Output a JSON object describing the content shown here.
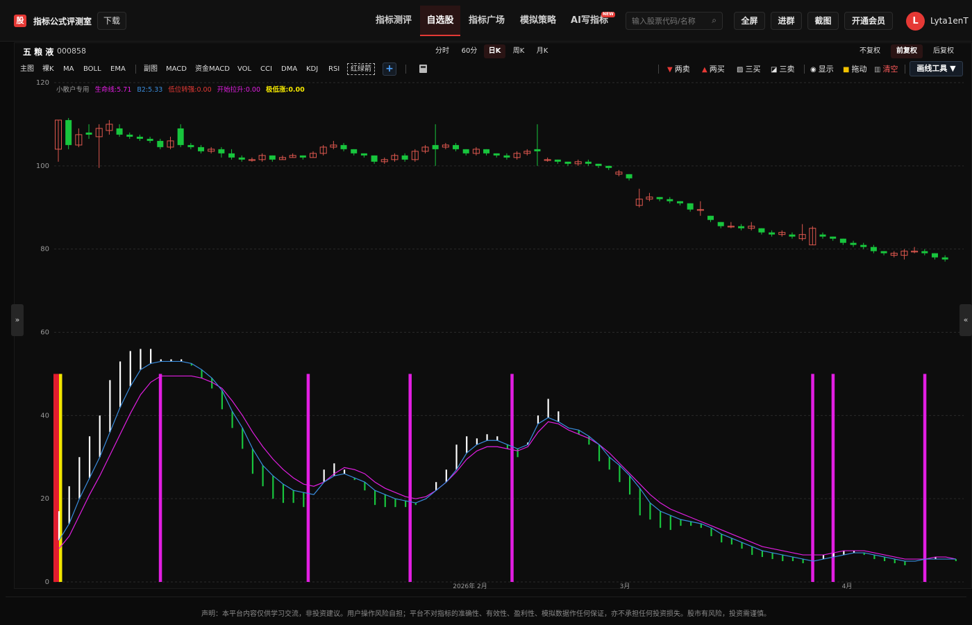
{
  "app": {
    "logo_char": "股",
    "title": "指标公式评测室",
    "download": "下载"
  },
  "nav": [
    {
      "label": "指标测评",
      "active": false
    },
    {
      "label": "自选股",
      "active": true
    },
    {
      "label": "指标广场",
      "active": false
    },
    {
      "label": "模拟策略",
      "active": false
    },
    {
      "label": "AI写指标",
      "active": false,
      "badge": "NEW"
    }
  ],
  "search": {
    "placeholder": "输入股票代码/名称",
    "value": ""
  },
  "top_buttons": {
    "fullscreen": "全屏",
    "join_group": "进群",
    "screenshot": "截图",
    "membership": "开通会员"
  },
  "user": {
    "avatar_letter": "L",
    "name": "Lyta1enT"
  },
  "stock": {
    "name": "五 粮 液",
    "code": "000858"
  },
  "period_tabs": [
    {
      "label": "分时",
      "active": false
    },
    {
      "label": "60分",
      "active": false
    },
    {
      "label": "日K",
      "active": true
    },
    {
      "label": "周K",
      "active": false
    },
    {
      "label": "月K",
      "active": false
    }
  ],
  "adjust_tabs": [
    {
      "label": "不复权",
      "active": false
    },
    {
      "label": "前复权",
      "active": true
    },
    {
      "label": "后复权",
      "active": false
    }
  ],
  "indicator_tabs": [
    "主图",
    "裸K",
    "MA",
    "BOLL",
    "EMA",
    "副图",
    "MACD",
    "资金MACD",
    "VOL",
    "CCI",
    "DMA",
    "KDJ",
    "RSI",
    "红绿箭"
  ],
  "draw_tools": {
    "two_sell": "两卖",
    "two_buy": "两买",
    "three_buy": "三买",
    "three_sell": "三卖",
    "show": "显示",
    "drag": "拖动",
    "clear": "清空",
    "draw_tools_btn": "画线工具 ▼"
  },
  "indicator_legend": [
    {
      "label": "小散户专用",
      "color": "#9a9a9a"
    },
    {
      "label": "生命线:5.71",
      "color": "#e21ee2"
    },
    {
      "label": "B2:5.33",
      "color": "#3a8dde"
    },
    {
      "label": "低位转强:0.00",
      "color": "#e53935"
    },
    {
      "label": "开始拉升:0.00",
      "color": "#e21ee2"
    },
    {
      "label": "极低涨:0.00",
      "color": "#f2e600"
    }
  ],
  "colors": {
    "up": "#e0584f",
    "down": "#18c53d",
    "magenta": "#e21ee2",
    "blue": "#3a8dde",
    "yellow": "#f2e600",
    "red": "#e11d2e"
  },
  "chart_data": {
    "type": "candlestick",
    "y_axis_labels": [
      "120",
      "100",
      "80",
      "60",
      "40",
      "20",
      "0"
    ],
    "x_axis_labels": [
      "2026年 2月",
      "3月",
      "4月"
    ],
    "y_range": [
      0,
      120
    ],
    "candles": [
      [
        104,
        111,
        101,
        111
      ],
      [
        111,
        105,
        104,
        111.5
      ],
      [
        105,
        107.5,
        104.5,
        109
      ],
      [
        108,
        107.5,
        106.5,
        110
      ],
      [
        107,
        109,
        99.5,
        110
      ],
      [
        108.5,
        110,
        107.5,
        111
      ],
      [
        109,
        107.5,
        107,
        110
      ],
      [
        107.5,
        107,
        106.5,
        108
      ],
      [
        107,
        106.5,
        106,
        107.5
      ],
      [
        106.5,
        106,
        105.5,
        107
      ],
      [
        106,
        104.5,
        104,
        106.5
      ],
      [
        104.5,
        106,
        104,
        107
      ],
      [
        109,
        105,
        104.5,
        110
      ],
      [
        105,
        104.5,
        104,
        105.5
      ],
      [
        104.5,
        103.5,
        103,
        105
      ],
      [
        103.5,
        104,
        103,
        104.5
      ],
      [
        104,
        103,
        102,
        104.5
      ],
      [
        103,
        102,
        101.5,
        104
      ],
      [
        102,
        101.5,
        101,
        102.5
      ],
      [
        101.5,
        101.5,
        101,
        102
      ],
      [
        101.5,
        102.5,
        101,
        103
      ],
      [
        102.5,
        101.5,
        101,
        102.5
      ],
      [
        101.5,
        102,
        101.5,
        102.5
      ],
      [
        102,
        102.5,
        102,
        103
      ],
      [
        102.5,
        102,
        101.5,
        102.5
      ],
      [
        102,
        103,
        102,
        103.5
      ],
      [
        103,
        104.5,
        102.5,
        105
      ],
      [
        104.5,
        105,
        104,
        106
      ],
      [
        105,
        104,
        103.5,
        105.5
      ],
      [
        104,
        103,
        102.5,
        104
      ],
      [
        103,
        102.5,
        102,
        103
      ],
      [
        102.5,
        101,
        100.5,
        102.5
      ],
      [
        101,
        101.5,
        100.5,
        102
      ],
      [
        101.5,
        102.5,
        101,
        103
      ],
      [
        102.5,
        101.5,
        101,
        103
      ],
      [
        101.5,
        103.5,
        101,
        104
      ],
      [
        103.5,
        104.5,
        103,
        105
      ],
      [
        105,
        104,
        100,
        110
      ],
      [
        104.5,
        105,
        104,
        105.5
      ],
      [
        105,
        104,
        103.5,
        105.5
      ],
      [
        104,
        103,
        102.5,
        104
      ],
      [
        103,
        104,
        102.5,
        104.5
      ],
      [
        104,
        103,
        102.5,
        104
      ],
      [
        103,
        102.5,
        102,
        103
      ],
      [
        102.5,
        102,
        101.5,
        103
      ],
      [
        102,
        103,
        101.5,
        103.5
      ],
      [
        103,
        103.5,
        102.5,
        104
      ],
      [
        104,
        103.5,
        100,
        110
      ],
      [
        101.5,
        101.5,
        101,
        102
      ],
      [
        101.5,
        101,
        100.5,
        101.5
      ],
      [
        101,
        100.5,
        100,
        101
      ],
      [
        100.5,
        101,
        100,
        101.5
      ],
      [
        101,
        100.5,
        100,
        101.5
      ],
      [
        100.5,
        100,
        99.5,
        100.5
      ],
      [
        100,
        99.5,
        99,
        100
      ],
      [
        98,
        98.5,
        97.5,
        99
      ],
      [
        98,
        97,
        96.5,
        98
      ],
      [
        90.5,
        92,
        90,
        94.5
      ],
      [
        92,
        92.5,
        91.5,
        93.5
      ],
      [
        92.5,
        92,
        91.5,
        92.5
      ],
      [
        92,
        91.5,
        91,
        92.5
      ],
      [
        91.5,
        91,
        90.5,
        91.5
      ],
      [
        91,
        89.5,
        89,
        91
      ],
      [
        89.5,
        89.5,
        88,
        91.5
      ],
      [
        88,
        87,
        86.5,
        88
      ],
      [
        86.5,
        85.5,
        85,
        86.5
      ],
      [
        85.5,
        85.5,
        85,
        86.5
      ],
      [
        85.5,
        85,
        84.5,
        86
      ],
      [
        85,
        85.5,
        84.5,
        86.5
      ],
      [
        85,
        84,
        83.5,
        85
      ],
      [
        84,
        83.5,
        83,
        84.5
      ],
      [
        83.5,
        84,
        83,
        84.5
      ],
      [
        83.5,
        83,
        82.5,
        84
      ],
      [
        82.5,
        83.5,
        82,
        86
      ],
      [
        81,
        85,
        81,
        85.5
      ],
      [
        83.5,
        83,
        82.5,
        84
      ],
      [
        83,
        82.5,
        82,
        83
      ],
      [
        82.5,
        81.5,
        81,
        82.5
      ],
      [
        81.5,
        81,
        80.5,
        82
      ],
      [
        81,
        80.5,
        80,
        81.5
      ],
      [
        80.5,
        79.5,
        79,
        81
      ],
      [
        79.5,
        79,
        78.5,
        79.5
      ],
      [
        78.5,
        79,
        78,
        79.5
      ],
      [
        78.5,
        79.5,
        77.5,
        80
      ],
      [
        79.5,
        79.5,
        79,
        80.5
      ],
      [
        79.5,
        79,
        78.5,
        80
      ],
      [
        79,
        78,
        77.5,
        79
      ],
      [
        78,
        77.5,
        77,
        78.5
      ]
    ],
    "sub_bars": [
      [
        10,
        17,
        10
      ],
      [
        14,
        23,
        14
      ],
      [
        20,
        30,
        20
      ],
      [
        25,
        35,
        25
      ],
      [
        30,
        40,
        30
      ],
      [
        36,
        48.5,
        36
      ],
      [
        42,
        53,
        42
      ],
      [
        47,
        55.5,
        47
      ],
      [
        51,
        56,
        51
      ],
      [
        52.5,
        56,
        52
      ],
      [
        53,
        53.5,
        52.5
      ],
      [
        53,
        53.5,
        52.5
      ],
      [
        53,
        53.5,
        52.5
      ],
      [
        52.5,
        52,
        52.5
      ],
      [
        51,
        49,
        51
      ],
      [
        49,
        46.5,
        49
      ],
      [
        46,
        41.5,
        46
      ],
      [
        41,
        37,
        41
      ],
      [
        37,
        32,
        37
      ],
      [
        32,
        26,
        32
      ],
      [
        28,
        23,
        28
      ],
      [
        25.5,
        20,
        25.5
      ],
      [
        23.5,
        19,
        23.5
      ],
      [
        22,
        19,
        22
      ],
      [
        21.5,
        18,
        21.5
      ],
      [
        21,
        21,
        21
      ],
      [
        24,
        27,
        24
      ],
      [
        25.5,
        28.5,
        25.5
      ],
      [
        26,
        27,
        26
      ],
      [
        25,
        24.5,
        25
      ],
      [
        24,
        22,
        24
      ],
      [
        22,
        18.5,
        22
      ],
      [
        21,
        18,
        21
      ],
      [
        20,
        18,
        20
      ],
      [
        19.5,
        18,
        19.5
      ],
      [
        19,
        18.5,
        19
      ],
      [
        20,
        20,
        20
      ],
      [
        22,
        24,
        22
      ],
      [
        24,
        27,
        24
      ],
      [
        27,
        33,
        27
      ],
      [
        31,
        35,
        31
      ],
      [
        33,
        34.5,
        33
      ],
      [
        34,
        35.5,
        34
      ],
      [
        34,
        35,
        34
      ],
      [
        33,
        32,
        33
      ],
      [
        32,
        30,
        32
      ],
      [
        33,
        33.5,
        33
      ],
      [
        38,
        40,
        38
      ],
      [
        39.5,
        44,
        39.5
      ],
      [
        38.5,
        41,
        38.5
      ],
      [
        37,
        37,
        37
      ],
      [
        36.5,
        35.5,
        36.5
      ],
      [
        35,
        33,
        35
      ],
      [
        33,
        29,
        33
      ],
      [
        30,
        27,
        30
      ],
      [
        28,
        24,
        28
      ],
      [
        25.5,
        21,
        25.5
      ],
      [
        22.5,
        16,
        22.5
      ],
      [
        19,
        15,
        19
      ],
      [
        17,
        13,
        17
      ],
      [
        16,
        12.5,
        16
      ],
      [
        15,
        13.5,
        15
      ],
      [
        14.5,
        13.5,
        14.5
      ],
      [
        14,
        13,
        14
      ],
      [
        13,
        11,
        13
      ],
      [
        11.5,
        9.5,
        11.5
      ],
      [
        10.5,
        9,
        10.5
      ],
      [
        9.5,
        8,
        9.5
      ],
      [
        8.5,
        6.5,
        8.5
      ],
      [
        7.5,
        6,
        7.5
      ],
      [
        7,
        5.5,
        7
      ],
      [
        6.5,
        5,
        6.5
      ],
      [
        6,
        5,
        6
      ],
      [
        5.5,
        4.5,
        5.5
      ],
      [
        5,
        5,
        5
      ],
      [
        5.5,
        6.5,
        5.5
      ],
      [
        6,
        7,
        6
      ],
      [
        6.5,
        7.5,
        6.5
      ],
      [
        7,
        7.5,
        7
      ],
      [
        7,
        6.5,
        7
      ],
      [
        6.5,
        5.5,
        6.5
      ],
      [
        6,
        5,
        6
      ],
      [
        5.5,
        4.5,
        5.5
      ],
      [
        5,
        4,
        5
      ],
      [
        5,
        5,
        5
      ],
      [
        5.5,
        5.5,
        5.5
      ],
      [
        5.5,
        6,
        5.5
      ],
      [
        5.5,
        5.5,
        5.5
      ],
      [
        5.5,
        5,
        5.5
      ]
    ],
    "blue_line": [
      10,
      14,
      20,
      25,
      30,
      36,
      42,
      47,
      51,
      52.5,
      53,
      53,
      53,
      52.5,
      51,
      49,
      46,
      41,
      37,
      32,
      28,
      25.5,
      23.5,
      22,
      21.5,
      21,
      24,
      25.5,
      26,
      25,
      24,
      22,
      21,
      20,
      19.5,
      19,
      20,
      22,
      24,
      27,
      31,
      33,
      34,
      34,
      33,
      32,
      33,
      38,
      39.5,
      38.5,
      37,
      36.5,
      35,
      33,
      30,
      28,
      25.5,
      22.5,
      19,
      17,
      16,
      15,
      14.5,
      14,
      13,
      11.5,
      10.5,
      9.5,
      8.5,
      7.5,
      7,
      6.5,
      6,
      5.5,
      5,
      5.5,
      6,
      6.5,
      7,
      7,
      6.5,
      6,
      5.5,
      5,
      5,
      5.5,
      5.5,
      5.5,
      5.5
    ],
    "magenta_line": [
      8,
      11,
      16,
      21,
      25.5,
      30.5,
      35.5,
      40.5,
      45,
      48,
      49.5,
      49.5,
      49.5,
      49.5,
      49,
      48,
      46.5,
      43.5,
      40,
      36,
      32.5,
      29.5,
      27,
      25,
      23.5,
      23,
      24,
      26,
      27.5,
      27,
      26,
      24,
      22.5,
      21.5,
      20.5,
      20,
      20.5,
      22,
      24,
      26.5,
      29.5,
      31.5,
      32.5,
      32.5,
      32,
      31.5,
      32.5,
      36,
      38.5,
      38,
      36.5,
      35.5,
      34.5,
      33,
      31,
      28.5,
      26,
      23.5,
      21,
      19,
      17.5,
      16.5,
      15.5,
      14.5,
      13.5,
      12.5,
      11.5,
      10.5,
      9.5,
      8.5,
      8,
      7.5,
      7,
      6.5,
      6.5,
      6.5,
      7,
      7.5,
      7.5,
      7.5,
      7,
      6.5,
      6,
      5.5,
      5.5,
      5.5,
      6,
      6,
      5.5
    ],
    "signal_bars": [
      {
        "idx": 0,
        "color": "#e11d2e"
      },
      {
        "idx": 0.25,
        "color": "#e11d2e"
      },
      {
        "idx": 0.5,
        "color": "#f2e600"
      },
      {
        "idx": 10,
        "color": "#e21ee2"
      },
      {
        "idx": 24.5,
        "color": "#e21ee2"
      },
      {
        "idx": 34.5,
        "color": "#e21ee2"
      },
      {
        "idx": 44.5,
        "color": "#e21ee2"
      },
      {
        "idx": 74,
        "color": "#e21ee2"
      },
      {
        "idx": 76,
        "color": "#e21ee2"
      },
      {
        "idx": 85,
        "color": "#e21ee2"
      }
    ]
  },
  "disclaimer": "声明：本平台内容仅供学习交流，非投资建议。用户操作风险自担；平台不对指标的准确性、有效性、盈利性、模拟数据作任何保证，亦不承担任何投资损失。股市有风险，投资需谨慎。",
  "handles": {
    "left": "»",
    "right": "«"
  }
}
